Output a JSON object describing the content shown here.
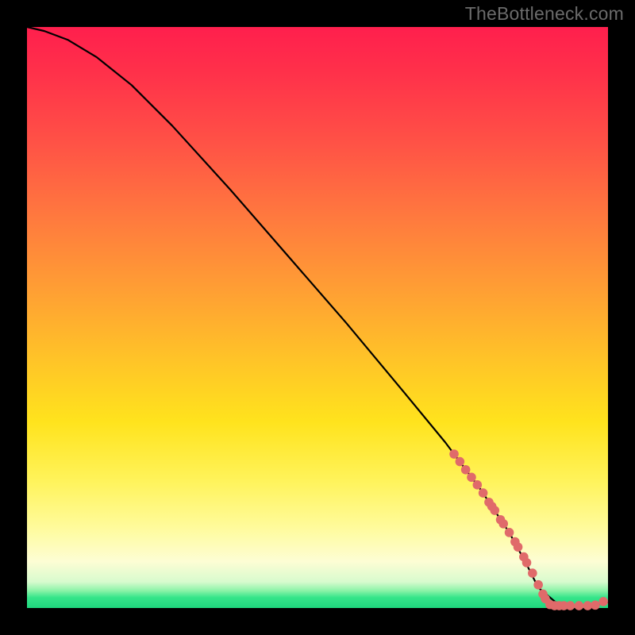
{
  "watermark": "TheBottleneck.com",
  "chart_data": {
    "type": "line",
    "title": "",
    "xlabel": "",
    "ylabel": "",
    "xlim": [
      0,
      1
    ],
    "ylim": [
      0,
      1
    ],
    "series": [
      {
        "name": "curve",
        "x": [
          0.0,
          0.03,
          0.07,
          0.12,
          0.18,
          0.25,
          0.35,
          0.45,
          0.55,
          0.65,
          0.72,
          0.78,
          0.83,
          0.86,
          0.88,
          0.91,
          0.94,
          0.97,
          1.0
        ],
        "y": [
          1.0,
          0.993,
          0.978,
          0.948,
          0.9,
          0.83,
          0.72,
          0.605,
          0.49,
          0.37,
          0.285,
          0.205,
          0.13,
          0.075,
          0.035,
          0.01,
          0.004,
          0.004,
          0.01
        ]
      }
    ],
    "highlight_points": {
      "name": "markers",
      "color": "#e06a6a",
      "x": [
        0.735,
        0.745,
        0.755,
        0.765,
        0.775,
        0.785,
        0.795,
        0.8,
        0.805,
        0.815,
        0.82,
        0.83,
        0.84,
        0.845,
        0.855,
        0.86,
        0.87,
        0.88,
        0.888,
        0.892,
        0.9,
        0.908,
        0.916,
        0.924,
        0.935,
        0.95,
        0.965,
        0.978,
        0.992
      ],
      "y": [
        0.265,
        0.252,
        0.238,
        0.225,
        0.212,
        0.198,
        0.182,
        0.175,
        0.168,
        0.152,
        0.145,
        0.13,
        0.114,
        0.105,
        0.088,
        0.078,
        0.06,
        0.04,
        0.024,
        0.016,
        0.006,
        0.004,
        0.004,
        0.004,
        0.004,
        0.004,
        0.004,
        0.005,
        0.011
      ]
    }
  }
}
